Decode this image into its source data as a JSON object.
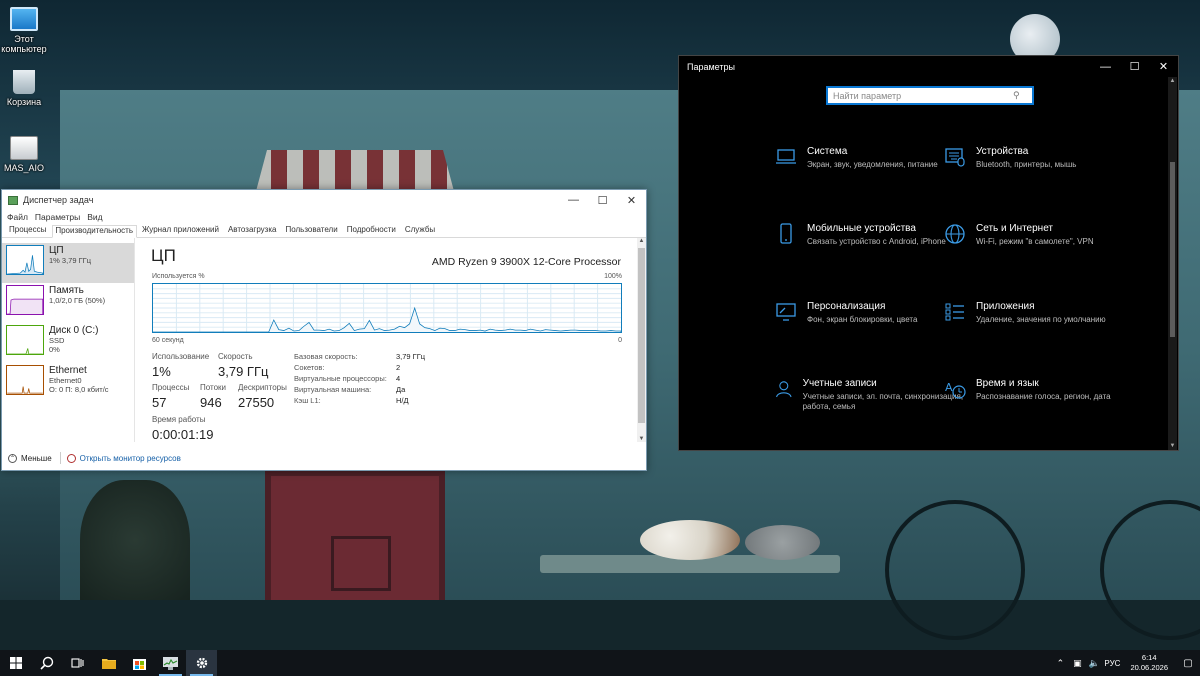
{
  "desktop": {
    "icons": [
      {
        "label": "Этот компьютер",
        "icon": "this-pc-icon"
      },
      {
        "label": "Корзина",
        "icon": "recycle-bin-icon"
      },
      {
        "label": "MAS_AIO",
        "icon": "script-file-icon"
      }
    ]
  },
  "task_manager": {
    "title": "Диспетчер задач",
    "menu": [
      "Файл",
      "Параметры",
      "Вид"
    ],
    "tabs": [
      "Процессы",
      "Производительность",
      "Журнал приложений",
      "Автозагрузка",
      "Пользователи",
      "Подробности",
      "Службы"
    ],
    "active_tab": "Производительность",
    "sidebar": [
      {
        "title": "ЦП",
        "sub1": "1% 3,79 ГГц",
        "sub2": "",
        "color": "#117dbb"
      },
      {
        "title": "Память",
        "sub1": "1,0/2,0 ГБ (50%)",
        "sub2": "",
        "color": "#8b12ae"
      },
      {
        "title": "Диск 0 (C:)",
        "sub1": "SSD",
        "sub2": "0%",
        "color": "#4da60c"
      },
      {
        "title": "Ethernet",
        "sub1": "Ethernet0",
        "sub2": "О: 0 П: 8,0 кбит/с",
        "color": "#a74f01"
      }
    ],
    "main": {
      "heading": "ЦП",
      "cpu_model": "AMD Ryzen 9 3900X 12-Core Processor",
      "graph_label": "Используется %",
      "graph_max": "100%",
      "graph_min": "0",
      "graph_span": "60 секунд",
      "graph_values": [
        0,
        0,
        0,
        0,
        0,
        0,
        0,
        0,
        0,
        0,
        0,
        0,
        0,
        0,
        0,
        0,
        0,
        0,
        0,
        0,
        0,
        0,
        0,
        0,
        25,
        5,
        3,
        8,
        2,
        3,
        12,
        20,
        4,
        4,
        3,
        6,
        2,
        3,
        9,
        18,
        3,
        6,
        7,
        24,
        4,
        7,
        3,
        4,
        6,
        12,
        9,
        17,
        50,
        17,
        9,
        7,
        3,
        8,
        7,
        3,
        3,
        6,
        5,
        3,
        3,
        4,
        2,
        6,
        4,
        3,
        4,
        6,
        4,
        4,
        3,
        6,
        4,
        2,
        5,
        4,
        3,
        2,
        3,
        4,
        4,
        3,
        3,
        3,
        3,
        2,
        2,
        3,
        2,
        2
      ],
      "stats": {
        "usage_label": "Использование",
        "usage_value": "1%",
        "speed_label": "Скорость",
        "speed_value": "3,79 ГГц",
        "processes_label": "Процессы",
        "processes_value": "57",
        "threads_label": "Потоки",
        "threads_value": "946",
        "handles_label": "Дескрипторы",
        "handles_value": "27550",
        "uptime_label": "Время работы",
        "uptime_value": "0:00:01:19"
      },
      "details": [
        {
          "label": "Базовая скорость:",
          "value": "3,79 ГГц"
        },
        {
          "label": "Сокетов:",
          "value": "2"
        },
        {
          "label": "Виртуальные процессоры:",
          "value": "4"
        },
        {
          "label": "Виртуальная машина:",
          "value": "Да"
        },
        {
          "label": "Кэш L1:",
          "value": "Н/Д"
        }
      ]
    },
    "footer": {
      "less": "Меньше",
      "monitor_link": "Открыть монитор ресурсов"
    }
  },
  "settings": {
    "title": "Параметры",
    "search_placeholder": "Найти параметр",
    "tiles": [
      {
        "title": "Система",
        "desc": "Экран, звук, уведомления, питание",
        "icon": "laptop-icon"
      },
      {
        "title": "Устройства",
        "desc": "Bluetooth, принтеры, мышь",
        "icon": "keyboard-icon"
      },
      {
        "title": "Мобильные устройства",
        "desc": "Связать устройство с Android, iPhone",
        "icon": "phone-icon"
      },
      {
        "title": "Сеть и Интернет",
        "desc": "Wi-Fi, режим \"в самолете\", VPN",
        "icon": "globe-icon"
      },
      {
        "title": "Персонализация",
        "desc": "Фон, экран блокировки, цвета",
        "icon": "paintbrush-icon"
      },
      {
        "title": "Приложения",
        "desc": "Удаление, значения по умолчанию",
        "icon": "apps-list-icon"
      },
      {
        "title": "Учетные записи",
        "desc": "Учетные записи, эл. почта, синхронизация, работа, семья",
        "icon": "person-icon"
      },
      {
        "title": "Время и язык",
        "desc": "Распознавание голоса, регион, дата",
        "icon": "time-language-icon"
      }
    ]
  },
  "taskbar": {
    "language": "РУС",
    "time": "6:14",
    "date": "20.06.2026",
    "accent": "#76b9ed"
  }
}
